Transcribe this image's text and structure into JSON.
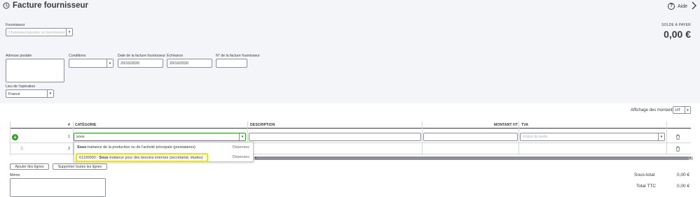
{
  "header": {
    "title": "Facture fournisseur",
    "help_label": "Aide",
    "history_icon": "history-icon",
    "help_icon": "help-circle-icon",
    "close_icon": "chevron-right-icon"
  },
  "form": {
    "fournisseur_label": "Fournisseur",
    "fournisseur_placeholder": "Choisissez/ajoutez un fournisseur",
    "adresse_label": "Adresse postale",
    "conditions_label": "Conditions",
    "date_label": "Date de la facture fournisseur",
    "date_value": "20/10/2020",
    "echeance_label": "Échéance",
    "echeance_value": "20/10/2020",
    "numero_label": "N° de la facture fournisseur",
    "lieu_label": "Lieu de l'opération",
    "lieu_value": "France"
  },
  "balance": {
    "label": "SOLDE À PAYER",
    "value": "0,00 €"
  },
  "amounts_display": {
    "label": "Affichage des montants",
    "value": "HT"
  },
  "table": {
    "headers": {
      "num": "#",
      "categorie": "CATÉGORIE",
      "description": "DESCRIPTION",
      "montant": "MONTANT HT",
      "tva": "TVA"
    },
    "rows": [
      {
        "num": "1",
        "categorie": "sous",
        "tva_placeholder": "Entrer du texte"
      },
      {
        "num": "2"
      }
    ]
  },
  "autocomplete": {
    "items": [
      {
        "match": "Sous",
        "rest": "-traitance de la production ou de l'activité principale (prestataires)",
        "type": "Dépenses"
      },
      {
        "prefix": "61100000 - ",
        "match": "Sous",
        "rest": "-traitance pour des besoins internes (secrétariat, études)",
        "type": "Dépenses"
      }
    ]
  },
  "buttons": {
    "add_lines": "Ajouter des lignes",
    "delete_lines": "Supprimer toutes les lignes"
  },
  "memo": {
    "label": "Mémo"
  },
  "totals": {
    "subtotal_label": "Sous-total",
    "subtotal_value": "0,00 €",
    "total_label": "Total TTC",
    "total_value": "0,00 €"
  },
  "colors": {
    "accent_green": "#2ca01c",
    "highlight_yellow": "#f2e400",
    "page_gray": "#f4f5f8"
  }
}
